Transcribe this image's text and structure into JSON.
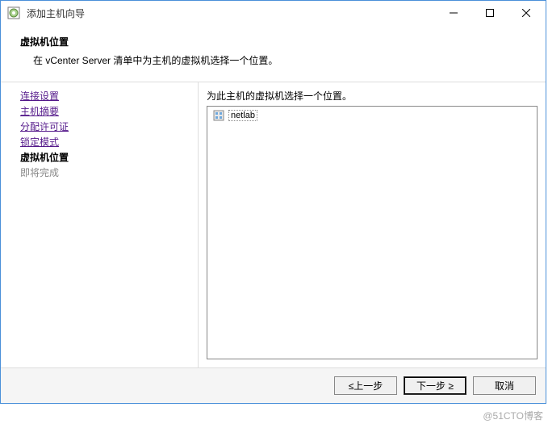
{
  "window": {
    "title": "添加主机向导"
  },
  "header": {
    "title": "虚拟机位置",
    "description": "在 vCenter Server 清单中为主机的虚拟机选择一个位置。"
  },
  "sidebar": {
    "items": [
      {
        "label": "连接设置",
        "state": "link"
      },
      {
        "label": "主机摘要",
        "state": "link"
      },
      {
        "label": "分配许可证",
        "state": "link"
      },
      {
        "label": "锁定模式",
        "state": "link"
      },
      {
        "label": "虚拟机位置",
        "state": "current"
      },
      {
        "label": "即将完成",
        "state": "disabled"
      }
    ]
  },
  "main": {
    "instruction": "为此主机的虚拟机选择一个位置。",
    "tree": [
      {
        "icon": "datacenter-icon",
        "label": "netlab"
      }
    ]
  },
  "footer": {
    "back": "≤上一步",
    "next": "下一步 ≥",
    "cancel": "取消"
  },
  "watermark": "@51CTO博客"
}
